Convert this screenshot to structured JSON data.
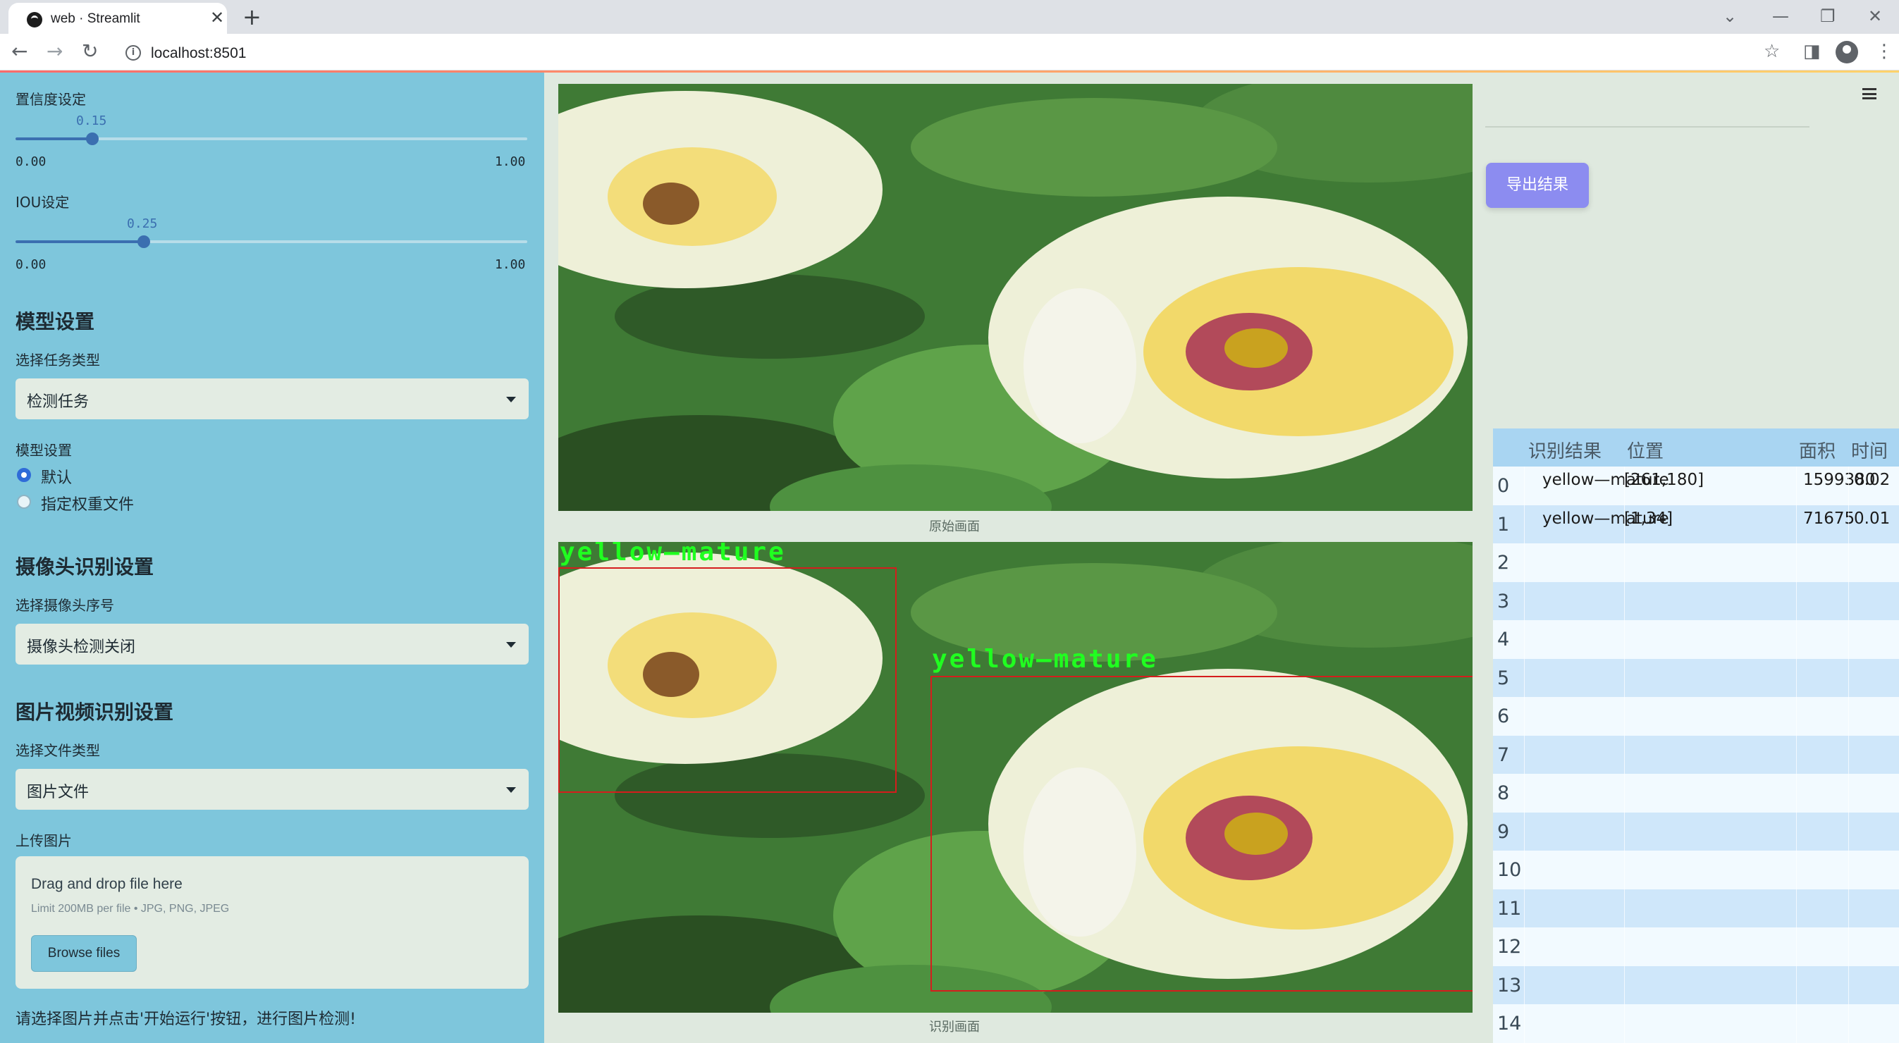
{
  "browser": {
    "tab_title": "web · Streamlit",
    "url": "localhost:8501"
  },
  "sidebar": {
    "confidence": {
      "label": "置信度设定",
      "value": "0.15",
      "min": "0.00",
      "max": "1.00",
      "fraction": 0.15
    },
    "iou": {
      "label": "IOU设定",
      "value": "0.25",
      "min": "0.00",
      "max": "1.00",
      "fraction": 0.25
    },
    "model_section": {
      "heading": "模型设置",
      "task_label": "选择任务类型",
      "task_value": "检测任务",
      "model_label": "模型设置",
      "options": [
        "默认",
        "指定权重文件"
      ],
      "selected_index": 0
    },
    "camera_section": {
      "heading": "摄像头识别设置",
      "camera_label": "选择摄像头序号",
      "camera_value": "摄像头检测关闭"
    },
    "media_section": {
      "heading": "图片视频识别设置",
      "file_type_label": "选择文件类型",
      "file_type_value": "图片文件",
      "upload_label": "上传图片",
      "upload_title": "Drag and drop file here",
      "upload_limit": "Limit 200MB per file • JPG, PNG, JPEG",
      "browse_label": "Browse files"
    },
    "note": "请选择图片并点击'开始运行'按钮，进行图片检测!"
  },
  "main": {
    "original_caption": "原始画面",
    "result_caption": "识别画面",
    "detections": [
      {
        "label": "yellow—mature"
      },
      {
        "label": "yellow—mature"
      }
    ],
    "export_label": "导出结果",
    "table": {
      "headers": [
        "识别结果",
        "位置",
        "面积",
        "时间"
      ],
      "rows": [
        {
          "idx": "0",
          "result": "yellow—mature",
          "position": "[261,180]",
          "area": "1599380",
          "time": "0.02"
        },
        {
          "idx": "1",
          "result": "yellow—mature",
          "position": "[1,34]",
          "area": "71675",
          "time": "0.01"
        },
        {
          "idx": "2"
        },
        {
          "idx": "3"
        },
        {
          "idx": "4"
        },
        {
          "idx": "5"
        },
        {
          "idx": "6"
        },
        {
          "idx": "7"
        },
        {
          "idx": "8"
        },
        {
          "idx": "9"
        },
        {
          "idx": "10"
        },
        {
          "idx": "11"
        },
        {
          "idx": "12"
        },
        {
          "idx": "13"
        },
        {
          "idx": "14"
        }
      ]
    }
  },
  "colors": {
    "sidebar_bg": "#7ec6dc",
    "accent": "#3b6fb0",
    "export_button": "#8c8cf0",
    "box": "#d51d1d",
    "label_text": "#20ff20"
  }
}
